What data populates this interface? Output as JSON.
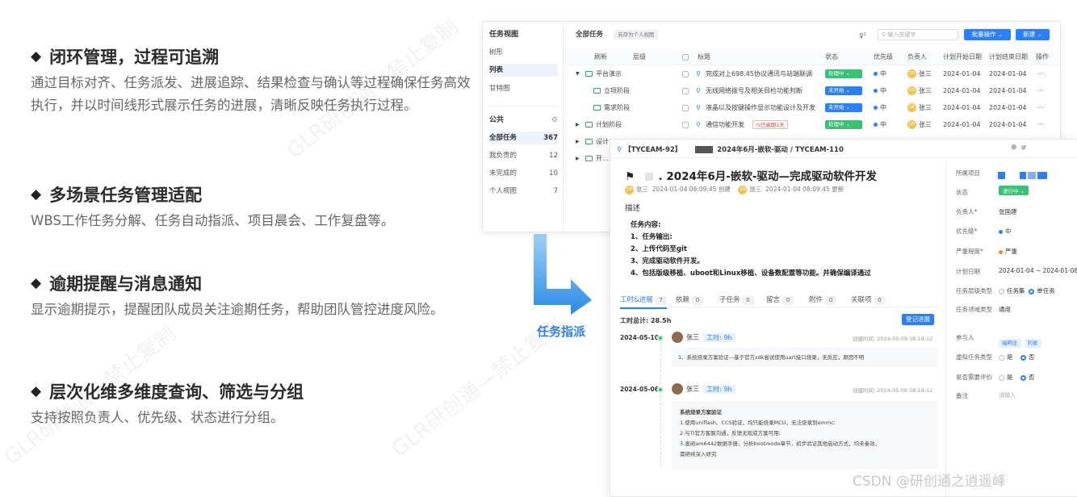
{
  "features": [
    {
      "title": "闭环管理，过程可追溯",
      "desc": "通过目标对齐、任务派发、进展追踪、结果检查与确认等过程确保任务高效执行，并以时间线形式展示任务的进展，清晰反映任务执行过程。"
    },
    {
      "title": "多场景任务管理适配",
      "desc": "WBS工作任务分解、任务自动指派、项目晨会、工作复盘等。"
    },
    {
      "title": "逾期提醒与消息通知",
      "desc": "显示逾期提示，提醒团队成员关注逾期任务，帮助团队管控进度风险。"
    },
    {
      "title": "层次化维多维度查询、筛选与分组",
      "desc": "支持按照负责人、优先级、状态进行分组。"
    }
  ],
  "bullet": "◆",
  "arrow_label": "任务指派",
  "list_win": {
    "side": {
      "title": "任务视图",
      "views": [
        "树形",
        "列表",
        "甘特图"
      ],
      "public_label": "公共",
      "groups": [
        {
          "label": "全部任务",
          "count": "367"
        },
        {
          "label": "我负责的",
          "count": "12"
        },
        {
          "label": "未完成的",
          "count": "10"
        },
        {
          "label": "个人视图",
          "count": "7"
        }
      ]
    },
    "toolbar": {
      "title": "全部任务",
      "save_view": "另存为个人视图",
      "search_placeholder": "输入关键字",
      "batch": "批量操作",
      "new": "新建",
      "filter_badge": "1"
    },
    "columns": [
      "刷新",
      "层级",
      "标题",
      "状态",
      "优先级",
      "负责人",
      "计划开始日期",
      "计划结束日期",
      "操作"
    ],
    "tree": [
      {
        "label": "平台演示",
        "expand": "▼"
      },
      {
        "label": "立项阶段",
        "expand": ""
      },
      {
        "label": "需求阶段",
        "expand": ""
      },
      {
        "label": "计划阶段",
        "expand": "▶"
      },
      {
        "label": "设计",
        "expand": "▶"
      },
      {
        "label": "开...",
        "expand": "▶"
      }
    ],
    "rows": [
      {
        "title": "完成对上698.45协议通讯与站端联调",
        "status": "处理中",
        "status_color": "#38c172",
        "priority": "中",
        "owner": "张三",
        "start": "2024-01-04",
        "end": "2024-01-04",
        "op": "···"
      },
      {
        "title": "无线网络拨号及相关目检功能判断",
        "status": "未开始",
        "status_color": "#2d7ff9",
        "priority": "中",
        "owner": "张三",
        "start": "2024-01-04",
        "end": "2024-01-04",
        "op": "···"
      },
      {
        "title": "液晶以及按键操作显示功能设计及开发",
        "status": "未开始",
        "status_color": "#2d7ff9",
        "priority": "中",
        "owner": "张三",
        "start": "2024-01-04",
        "end": "2024-01-04",
        "op": "···"
      },
      {
        "title": "通信功能开发",
        "overdue": "已逾期1天",
        "status": "处理中",
        "status_color": "#38c172",
        "priority": "中",
        "owner": "张三",
        "start": "2024-01-04",
        "end": "2024-01-04",
        "op": "···"
      }
    ],
    "avatar_text": "DS"
  },
  "detail_win": {
    "crumb_id": "【TYCEAM-92】",
    "crumb_path": "2024年6月-嵌软-驱动 / TYCEAM-110",
    "title": ". 2024年6月-嵌软-驱动—完成驱动软件开发",
    "creator": "张三",
    "created": "2024-01-04 08:09:45 创建",
    "updater": "张三",
    "updated": "2024-01-04 08:09:45 更新",
    "desc_label": "描述",
    "content_title": "任务内容:",
    "content": [
      "1、任务输出:",
      "2、上传代码至git",
      "3、完成驱动软件开发。",
      "4、包括版级移植、uboot和Linux移植、设备数配置等功能。并确保编译通过"
    ],
    "tabs": [
      {
        "label": "工时&进展",
        "count": "7"
      },
      {
        "label": "依赖",
        "count": "0"
      },
      {
        "label": "子任务",
        "count": "0"
      },
      {
        "label": "留言",
        "count": "0"
      },
      {
        "label": "附件",
        "count": "0"
      },
      {
        "label": "关联项",
        "count": "0"
      }
    ],
    "total_hours": "工时总计: 28.5h",
    "log_btn": "登记进展",
    "logs": [
      {
        "date": "2024-05-10",
        "user": "张三",
        "hours": "工时: 9h",
        "created": "创建时间: 2024-05-09 08:19:12",
        "body": [
          "1、系统烧录方案验证—基于官方sdk尝试使用uart接口烧录，无反应，原因不明"
        ]
      },
      {
        "date": "2024-05-06",
        "user": "张三",
        "hours": "工时: 9h",
        "created": "创建时间: 2024-05-06 08:19:12",
        "body": [
          "系统烧录方案验证",
          "1.使用uniflash、CCS验证，均只能烧录MCU，无法烧录到emmc;",
          "2.与TI官方客服沟通，反馈无现成方案可用;",
          "3.查阅am6442数据手册，分析bootmode章节，初步验证其他启动方式，均未奏效，",
          "需继续深入研究"
        ]
      }
    ],
    "props": [
      {
        "label": "所属项目",
        "value": ""
      },
      {
        "label": "状态",
        "value": "进行中 ⌄"
      },
      {
        "label": "负责人*",
        "value": "张国建"
      },
      {
        "label": "优先级*",
        "value": "中"
      },
      {
        "label": "严重程度*",
        "value": "严重"
      },
      {
        "label": "计划日期",
        "value": "2024-01-04 ~ 2024-01-08"
      },
      {
        "label": "任务层级类型",
        "opt1": "任务集",
        "opt2": "单任务"
      },
      {
        "label": "任务领域类型",
        "value": "通用"
      },
      {
        "label": "参与人",
        "tags": [
          "福明全",
          "刘星"
        ]
      },
      {
        "label": "虚拟任务类型",
        "opt1": "是",
        "opt2": "否"
      },
      {
        "label": "是否需要评价",
        "opt1": "是",
        "opt2": "否"
      },
      {
        "label": "备注",
        "value": "请输入"
      }
    ]
  },
  "footer_credit": "CSDN @研创通之逍遥峰",
  "watermark_text": "GLR研创通—禁止复制"
}
